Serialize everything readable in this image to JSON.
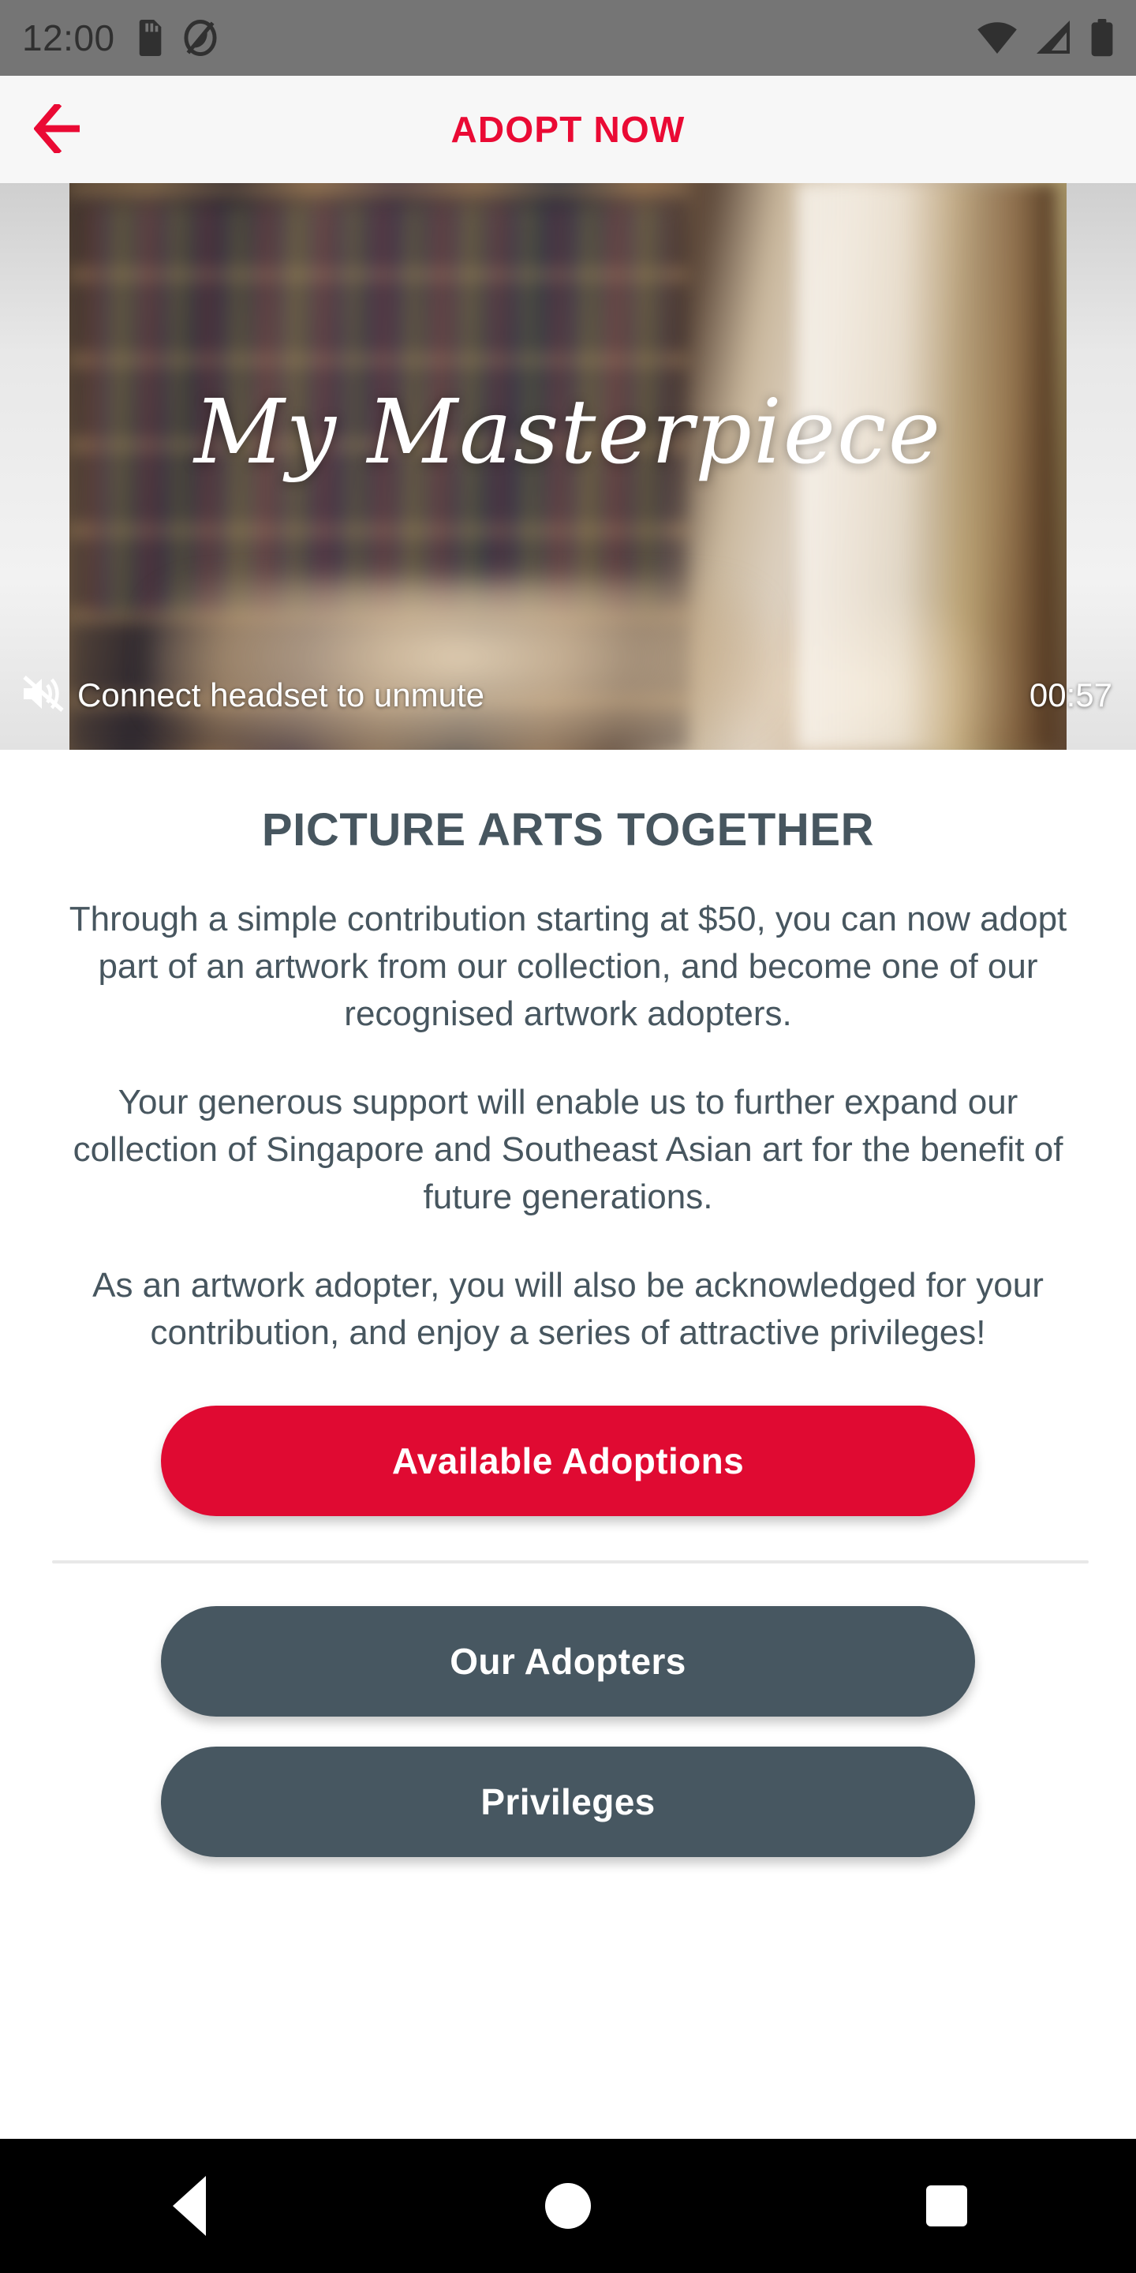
{
  "status_bar": {
    "time": "12:00",
    "icons_left": [
      "sd-card-icon",
      "do-not-disturb-icon"
    ],
    "icons_right": [
      "wifi-icon",
      "cellular-signal-icon",
      "battery-icon"
    ],
    "background_color": "#757575"
  },
  "app_bar": {
    "back_icon": "arrow-left-icon",
    "title": "ADOPT NOW",
    "title_color": "#ea0a34",
    "background_color": "#f7f7f7"
  },
  "video": {
    "overlay_title": "My Masterpiece",
    "mute_icon": "volume-off-icon",
    "mute_message": "Connect headset to unmute",
    "duration": "00:57"
  },
  "main": {
    "heading": "PICTURE ARTS TOGETHER",
    "heading_color": "#47565f",
    "paragraphs": [
      "Through a simple contribution starting at $50, you can now adopt part of an artwork from our collection, and become one of our recognised artwork adopters.",
      "Your generous support will enable us to further expand our collection of Singapore and Southeast Asian art for the benefit of future generations.",
      "As an artwork adopter, you will also be acknowledged for your contribution, and enjoy a series of attractive privileges!"
    ],
    "buttons": {
      "primary": {
        "label": "Available Adoptions",
        "color": "#e00a32"
      },
      "secondary": [
        {
          "label": "Our Adopters",
          "color": "#475761"
        },
        {
          "label": "Privileges",
          "color": "#475761"
        }
      ]
    }
  },
  "nav_bar": {
    "back_label": "back-button",
    "home_label": "home-button",
    "recents_label": "recents-button",
    "background_color": "#000000"
  }
}
